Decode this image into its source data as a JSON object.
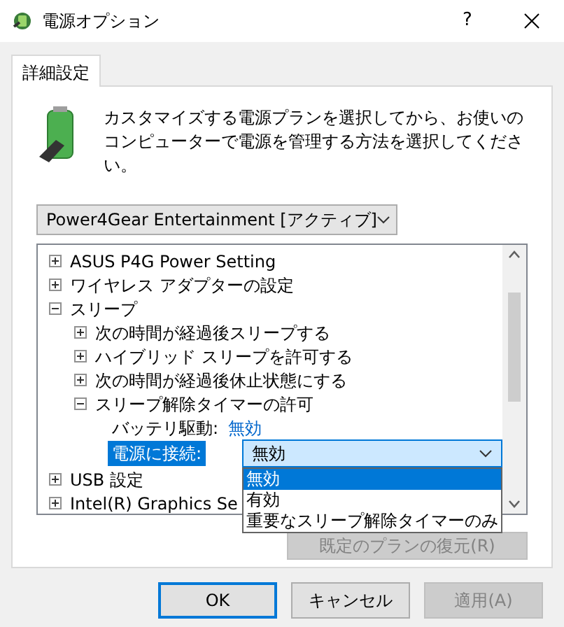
{
  "window": {
    "title": "電源オプション",
    "help": "?"
  },
  "tabs": [
    {
      "label": "詳細設定",
      "selected": true
    }
  ],
  "description": "カスタマイズする電源プランを選択してから、お使いのコンピューターで電源を管理する方法を選択してください。",
  "plan_select": {
    "value": "Power4Gear Entertainment [アクティブ]"
  },
  "settings_tree": [
    {
      "kind": "node",
      "label": "ASUS P4G Power Setting",
      "expanded": false
    },
    {
      "kind": "node",
      "label": "ワイヤレス アダプターの設定",
      "expanded": false
    },
    {
      "kind": "node",
      "label": "スリープ",
      "expanded": true,
      "children": [
        {
          "kind": "node",
          "label": "次の時間が経過後スリープする",
          "expanded": false
        },
        {
          "kind": "node",
          "label": "ハイブリッド スリープを許可する",
          "expanded": false
        },
        {
          "kind": "node",
          "label": "次の時間が経過後休止状態にする",
          "expanded": false
        },
        {
          "kind": "node",
          "label": "スリープ解除タイマーの許可",
          "expanded": true,
          "children": [
            {
              "kind": "value",
              "label": "バッテリ駆動:",
              "value": "無効",
              "selected": false
            },
            {
              "kind": "combo",
              "label": "電源に接続:",
              "value": "無効",
              "selected": true,
              "options": [
                {
                  "label": "無効",
                  "selected": true
                },
                {
                  "label": "有効",
                  "selected": false
                },
                {
                  "label": "重要なスリープ解除タイマーのみ",
                  "selected": false
                }
              ]
            }
          ]
        }
      ]
    },
    {
      "kind": "node",
      "label": "USB 設定",
      "expanded": false
    },
    {
      "kind": "node",
      "label": "Intel(R) Graphics Se",
      "expanded": false
    }
  ],
  "restore_button": {
    "label": "既定のプランの復元(R)",
    "disabled": true
  },
  "buttons": [
    {
      "label": "OK",
      "default": true,
      "disabled": false
    },
    {
      "label": "キャンセル",
      "default": false,
      "disabled": false
    },
    {
      "label": "適用(A)",
      "default": false,
      "disabled": true
    }
  ]
}
